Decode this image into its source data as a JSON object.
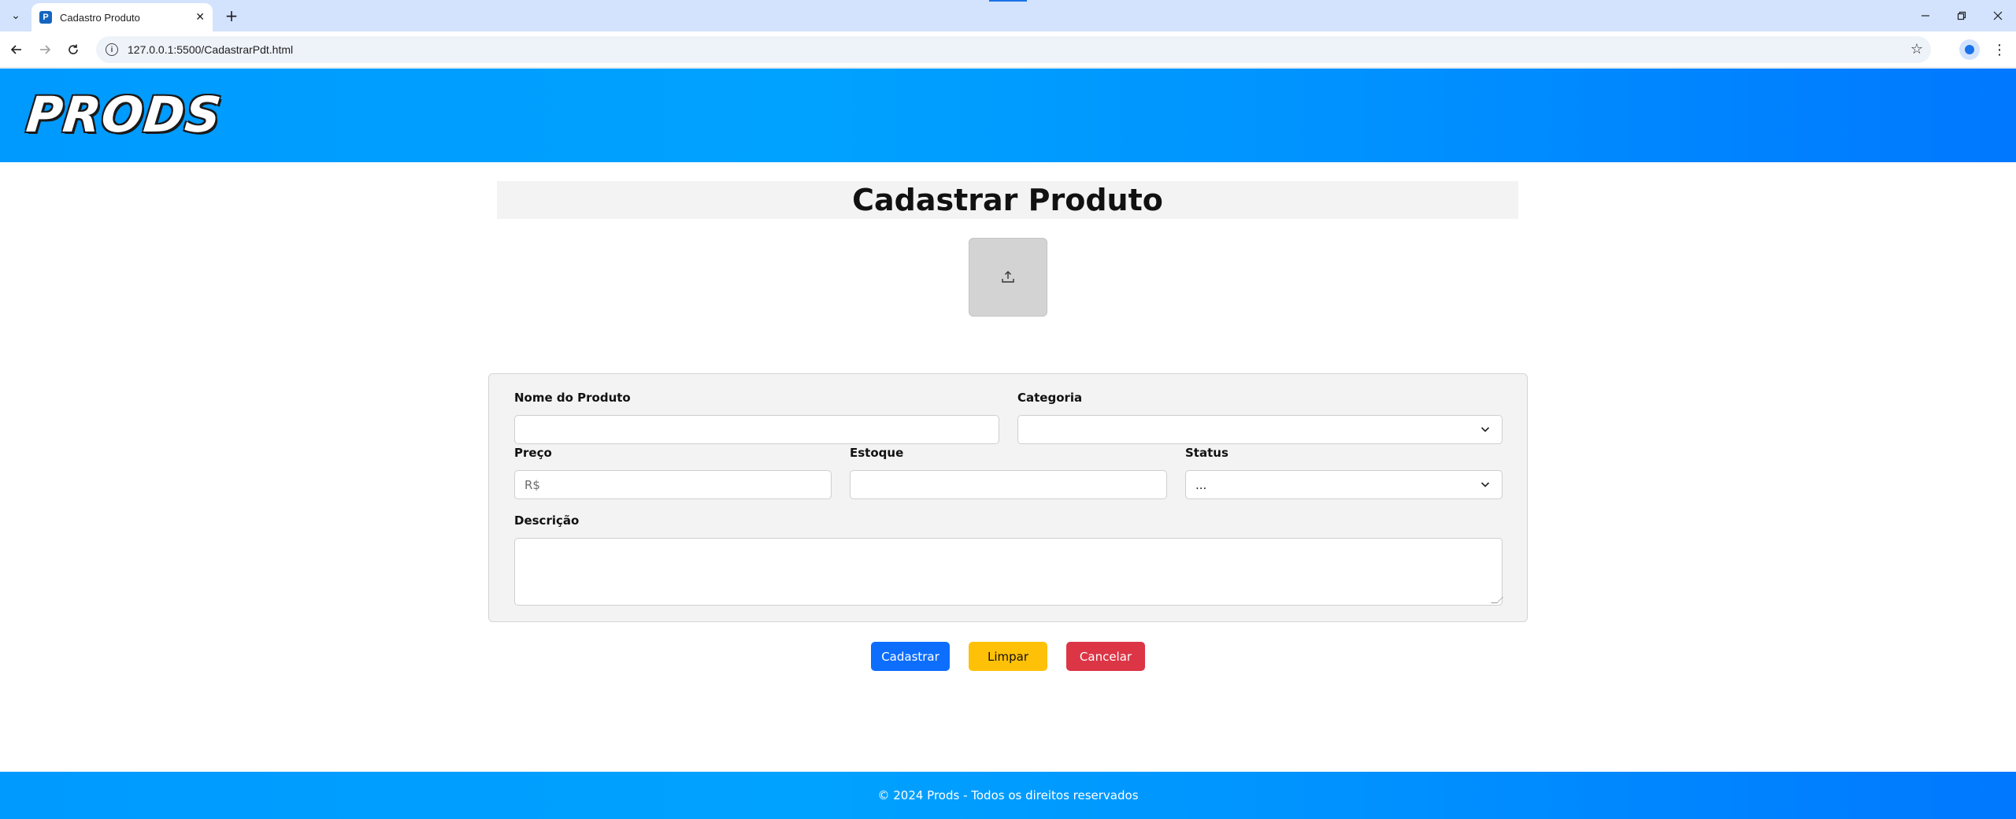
{
  "browser": {
    "tab_title": "Cadastro Produto",
    "favicon_letter": "P",
    "url": "127.0.0.1:5500/CadastrarPdt.html"
  },
  "header": {
    "logo": "PRODS"
  },
  "main": {
    "title": "Cadastrar Produto",
    "upload_icon": "upload-icon"
  },
  "form": {
    "name_label": "Nome do Produto",
    "name_value": "",
    "category_label": "Categoria",
    "category_value": "",
    "price_label": "Preço",
    "price_placeholder": "R$",
    "stock_label": "Estoque",
    "stock_value": "",
    "status_label": "Status",
    "status_value": "...",
    "description_label": "Descrição",
    "description_value": ""
  },
  "actions": {
    "submit_label": "Cadastrar",
    "clear_label": "Limpar",
    "cancel_label": "Cancelar"
  },
  "footer": {
    "text": "© 2024 Prods - Todos os direitos reservados"
  },
  "colors": {
    "brand_blue": "#009aff",
    "primary": "#0d6efd",
    "warning": "#ffc107",
    "danger": "#dc3545"
  }
}
